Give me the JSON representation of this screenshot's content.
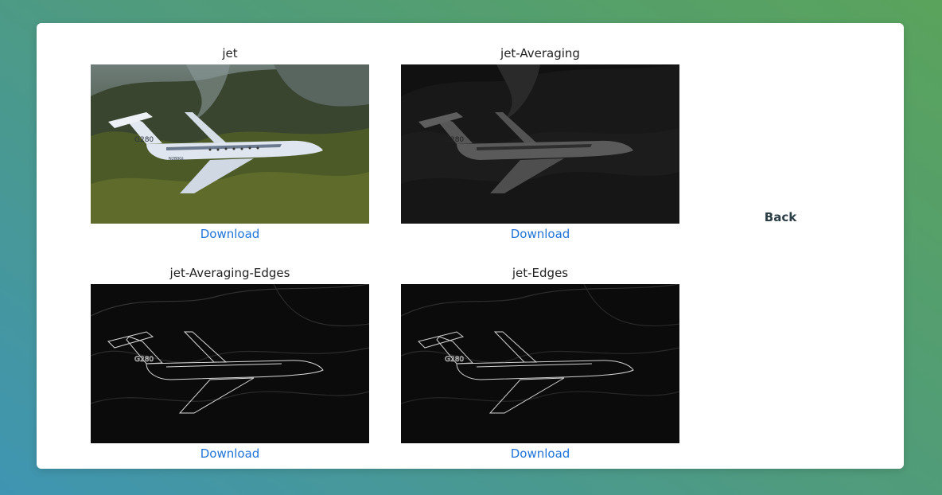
{
  "images": [
    {
      "title": "jet",
      "download_label": "Download",
      "variant": "original"
    },
    {
      "title": "jet-Averaging",
      "download_label": "Download",
      "variant": "averaging"
    },
    {
      "title": "jet-Averaging-Edges",
      "download_label": "Download",
      "variant": "edges"
    },
    {
      "title": "jet-Edges",
      "download_label": "Download",
      "variant": "edges"
    }
  ],
  "back_label": "Back",
  "jet_tail_text": "G280",
  "jet_reg_text": "N280GL",
  "colors": {
    "link": "#1f74d8",
    "back": "#2c3e46",
    "card": "#ffffff"
  }
}
